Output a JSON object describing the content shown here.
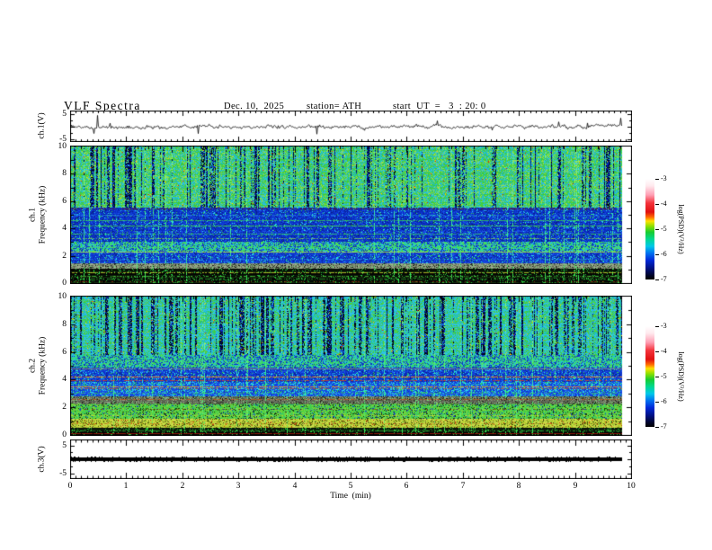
{
  "header": {
    "title": "VLF Spectra",
    "date": "Dec. 10,  2025",
    "station": "station= ATH",
    "start_ut": "start  UT  =   3  : 20: 0"
  },
  "axes": {
    "x": {
      "label": "Time  (min)",
      "ticks": [
        "0",
        "1",
        "2",
        "3",
        "4",
        "5",
        "6",
        "7",
        "8",
        "9",
        "10"
      ]
    },
    "wave_yticks": [
      "5",
      "-5"
    ],
    "spec_yticks": [
      "10",
      "8",
      "6",
      "4",
      "2",
      "0"
    ],
    "ch3_yticks": [
      "5",
      "-5"
    ]
  },
  "panels": {
    "wave": {
      "label_rot": "ch.1(V)"
    },
    "spec1": {
      "label_ch": "ch.1",
      "label_freq": "Frequency  (kHz)"
    },
    "spec2": {
      "label_ch": "ch.2",
      "label_freq": "Frequency  (kHz)"
    },
    "ch3": {
      "label_rot": "ch.3(V)"
    }
  },
  "colorbar": {
    "label": "log(PSD)(V²/Hz)",
    "ticks": [
      "-3",
      "-4",
      "-5",
      "-6",
      "-7"
    ],
    "gradient": [
      {
        "p": 0.0,
        "c": "#ffffff"
      },
      {
        "p": 0.07,
        "c": "#ffe9ee"
      },
      {
        "p": 0.16,
        "c": "#ff9fb4"
      },
      {
        "p": 0.24,
        "c": "#f4333c"
      },
      {
        "p": 0.33,
        "c": "#e01010"
      },
      {
        "p": 0.38,
        "c": "#ff6a00"
      },
      {
        "p": 0.42,
        "c": "#ffe000"
      },
      {
        "p": 0.47,
        "c": "#8fe000"
      },
      {
        "p": 0.53,
        "c": "#18cc30"
      },
      {
        "p": 0.6,
        "c": "#00d890"
      },
      {
        "p": 0.67,
        "c": "#00c8e8"
      },
      {
        "p": 0.74,
        "c": "#0070f0"
      },
      {
        "p": 0.81,
        "c": "#0028d8"
      },
      {
        "p": 0.89,
        "c": "#001080"
      },
      {
        "p": 0.96,
        "c": "#000428"
      },
      {
        "p": 1.0,
        "c": "#000000"
      }
    ]
  },
  "chart_data": [
    {
      "type": "line",
      "panel": "ch1_voltage",
      "xlabel": "Time (min)",
      "ylabel": "ch.1(V)",
      "xlim": [
        0,
        10
      ],
      "ylim": [
        -5,
        5
      ],
      "yticks": [
        5,
        -5
      ],
      "baseline_V": 0.2,
      "noise_rms_V": 0.6,
      "description": "continuous noisy trace centered near 0 V with impulsive spikes reaching about +4 / -4 V; data extends 0 to ~9.8 min"
    },
    {
      "type": "heatmap",
      "panel": "ch1_spectrogram",
      "xlabel": "Time (min)",
      "ylabel": "ch.1 Frequency (kHz)",
      "xlim": [
        0,
        10
      ],
      "ylim": [
        0,
        10
      ],
      "colorbar": {
        "label": "log(PSD)(V²/Hz)",
        "range": [
          -7,
          -3
        ],
        "ticks": [
          -3,
          -4,
          -5,
          -6,
          -7
        ]
      },
      "streak_p": 0.13,
      "vlines": 30,
      "bands": [
        {
          "f": [
            5.55,
            10
          ],
          "mode": "streaky",
          "psd": "-4.5 to -5.5 with vertical dropouts to -7",
          "palette": [
            "#3ecb3e",
            "#5ad23c",
            "#1fc9a0",
            "#2fc4e8",
            "#93e04e",
            "#27b7d8"
          ],
          "dark": [
            "#041694",
            "#001060",
            "#000a38",
            "#010101",
            "#0a2fd0"
          ],
          "warm": 0.01
        },
        {
          "f": [
            3.05,
            5.55
          ],
          "mode": "blue",
          "psd": "-6.3",
          "palette": [
            "#0a2cc0",
            "#0e3cd8",
            "#1750ea",
            "#091f86"
          ],
          "cyan": 0.06,
          "green": 0.035
        },
        {
          "f": [
            2.3,
            3.05
          ],
          "mode": "cyan",
          "psd": "-5.3",
          "palette": [
            "#1fd0ae",
            "#38d84e",
            "#2bb4ec",
            "#59de62"
          ],
          "blue": 0.3
        },
        {
          "f": [
            1.45,
            2.3
          ],
          "mode": "blue",
          "psd": "-6.2",
          "palette": [
            "#0c31c6",
            "#1244dc",
            "#1a55ee",
            "#0a2390"
          ],
          "cyan": 0.09,
          "green": 0.03
        },
        {
          "f": [
            1.02,
            1.45
          ],
          "mode": "gray",
          "psd": "-5.8",
          "palette": [
            "#8e9e80",
            "#7b8a6e",
            "#a0ad92",
            "#5c6750"
          ]
        },
        {
          "f": [
            0,
            1.02
          ],
          "mode": "stripes",
          "psd": "-7 with narrow emission lines",
          "rows": [
            "#030503",
            "#0c1a0a",
            "#010201",
            "#16300f",
            "#050905",
            "#020302"
          ],
          "dash": 0.1
        }
      ],
      "hlines": [
        {
          "f": 5.45,
          "color": "#6e1606",
          "alpha": 0.85,
          "dash": 0.55
        },
        {
          "f": 5.0,
          "color": "#2bb4ec",
          "alpha": 0.5,
          "dash": 0.6
        },
        {
          "f": 4.62,
          "color": "#38d84e",
          "alpha": 0.75,
          "dash": 0.8
        },
        {
          "f": 4.18,
          "color": "#44e04a",
          "alpha": 0.85,
          "dash": 0.9
        },
        {
          "f": 3.62,
          "color": "#38d84e",
          "alpha": 0.7,
          "dash": 0.7
        },
        {
          "f": 3.32,
          "color": "#8ce04a",
          "alpha": 0.7,
          "dash": 0.6
        },
        {
          "f": 2.62,
          "color": "#3ee060",
          "alpha": 0.8,
          "dash": 0.55
        },
        {
          "f": 2.3,
          "color": "#b2ec38",
          "alpha": 0.85,
          "dash": 0.9
        },
        {
          "f": 1.75,
          "color": "#2bb4ec",
          "alpha": 0.5,
          "dash": 0.5
        },
        {
          "f": 0.78,
          "color": "#ccd42c",
          "alpha": 0.8,
          "dash": 0.6
        },
        {
          "f": 0.55,
          "color": "#55d23c",
          "alpha": 0.7,
          "dash": 0.45
        },
        {
          "f": 0.3,
          "color": "#3ecb3e",
          "alpha": 0.6,
          "dash": 0.5
        },
        {
          "f": 0.15,
          "color": "#c23c10",
          "alpha": 0.6,
          "dash": 0.35
        }
      ]
    },
    {
      "type": "heatmap",
      "panel": "ch2_spectrogram",
      "xlabel": "Time (min)",
      "ylabel": "ch.2 Frequency (kHz)",
      "xlim": [
        0,
        10
      ],
      "ylim": [
        0,
        10
      ],
      "colorbar": {
        "label": "log(PSD)(V²/Hz)",
        "range": [
          -7,
          -3
        ],
        "ticks": [
          -3,
          -4,
          -5,
          -6,
          -7
        ]
      },
      "streak_p": 0.16,
      "vlines": 34,
      "bands": [
        {
          "f": [
            5.8,
            10
          ],
          "mode": "streaky",
          "psd": "-5 with deep vertical dropouts",
          "palette": [
            "#2fc4e8",
            "#3ecb3e",
            "#1fc9a0",
            "#5ad23c",
            "#27b7d8"
          ],
          "dark": [
            "#03115c",
            "#000a38",
            "#010101",
            "#0a2fd0"
          ],
          "warm": 0.012
        },
        {
          "f": [
            4.85,
            5.8
          ],
          "mode": "cyan",
          "psd": "-5.4",
          "palette": [
            "#2bc4d4",
            "#38d84e",
            "#1fd0ae",
            "#4fd86a"
          ],
          "blue": 0.28
        },
        {
          "f": [
            3.85,
            4.85
          ],
          "mode": "blue",
          "psd": "-6.1",
          "palette": [
            "#0c31c6",
            "#1244dc",
            "#1a55ee",
            "#0a2390"
          ],
          "cyan": 0.12,
          "green": 0.05
        },
        {
          "f": [
            2.8,
            3.85
          ],
          "mode": "blue",
          "psd": "-5.9",
          "palette": [
            "#1244dc",
            "#1a55ee",
            "#2bb4ec",
            "#0c31c6"
          ],
          "cyan": 0.18,
          "green": 0.1
        },
        {
          "f": [
            2.25,
            2.8
          ],
          "mode": "gray",
          "psd": "-5.6",
          "palette": [
            "#6f7a64",
            "#5c6750",
            "#8e9e80",
            "#4a5540"
          ]
        },
        {
          "f": [
            1.15,
            2.25
          ],
          "mode": "green",
          "psd": "-5.0",
          "palette": [
            "#4ccf3a",
            "#63d845",
            "#2fc96b",
            "#8ad13c"
          ],
          "darksp": 0.15,
          "blue": 0.06
        },
        {
          "f": [
            0.55,
            1.15
          ],
          "mode": "yellow",
          "psd": "-4.4",
          "palette": [
            "#b8d12a",
            "#ccd943",
            "#9cc431",
            "#d2dc56"
          ]
        },
        {
          "f": [
            0,
            0.55
          ],
          "mode": "stripes",
          "psd": "-7 with narrow lines",
          "rows": [
            "#030503",
            "#123312",
            "#020302",
            "#0c1a0a",
            "#050905"
          ],
          "dash": 0.12
        }
      ],
      "hlines": [
        {
          "f": 4.78,
          "color": "#8a9088",
          "alpha": 0.9,
          "dash": 0.95
        },
        {
          "f": 4.2,
          "color": "#ff7a14",
          "alpha": 0.9,
          "dash": 0.8
        },
        {
          "f": 3.95,
          "color": "#e03c0c",
          "alpha": 0.8,
          "dash": 0.6
        },
        {
          "f": 3.52,
          "color": "#ff8c1a",
          "alpha": 0.85,
          "dash": 0.75
        },
        {
          "f": 3.35,
          "color": "#d9540f",
          "alpha": 0.7,
          "dash": 0.5
        },
        {
          "f": 3.05,
          "color": "#44e04a",
          "alpha": 0.6,
          "dash": 0.5
        },
        {
          "f": 2.62,
          "color": "#c2551f",
          "alpha": 0.85,
          "dash": 0.6
        },
        {
          "f": 2.48,
          "color": "#62665c",
          "alpha": 0.9,
          "dash": 0.7
        },
        {
          "f": 2.28,
          "color": "#52564c",
          "alpha": 0.85,
          "dash": 0.6
        },
        {
          "f": 1.9,
          "color": "#8a2c0a",
          "alpha": 0.6,
          "dash": 0.4
        },
        {
          "f": 1.45,
          "color": "#e0de2c",
          "alpha": 0.6,
          "dash": 0.5
        },
        {
          "f": 0.85,
          "color": "#c23c10",
          "alpha": 0.5,
          "dash": 0.4
        },
        {
          "f": 0.3,
          "color": "#3ecb3e",
          "alpha": 0.7,
          "dash": 0.6
        },
        {
          "f": 0.1,
          "color": "#8f1408",
          "alpha": 0.95,
          "dash": 0.98
        }
      ]
    },
    {
      "type": "line",
      "panel": "ch3_voltage",
      "xlabel": "Time (min)",
      "ylabel": "ch.3(V)",
      "xlim": [
        0,
        10
      ],
      "ylim": [
        -5,
        5
      ],
      "yticks": [
        5,
        -5
      ],
      "value_V": 0,
      "description": "flat thick line at 0 V for the full record"
    }
  ]
}
